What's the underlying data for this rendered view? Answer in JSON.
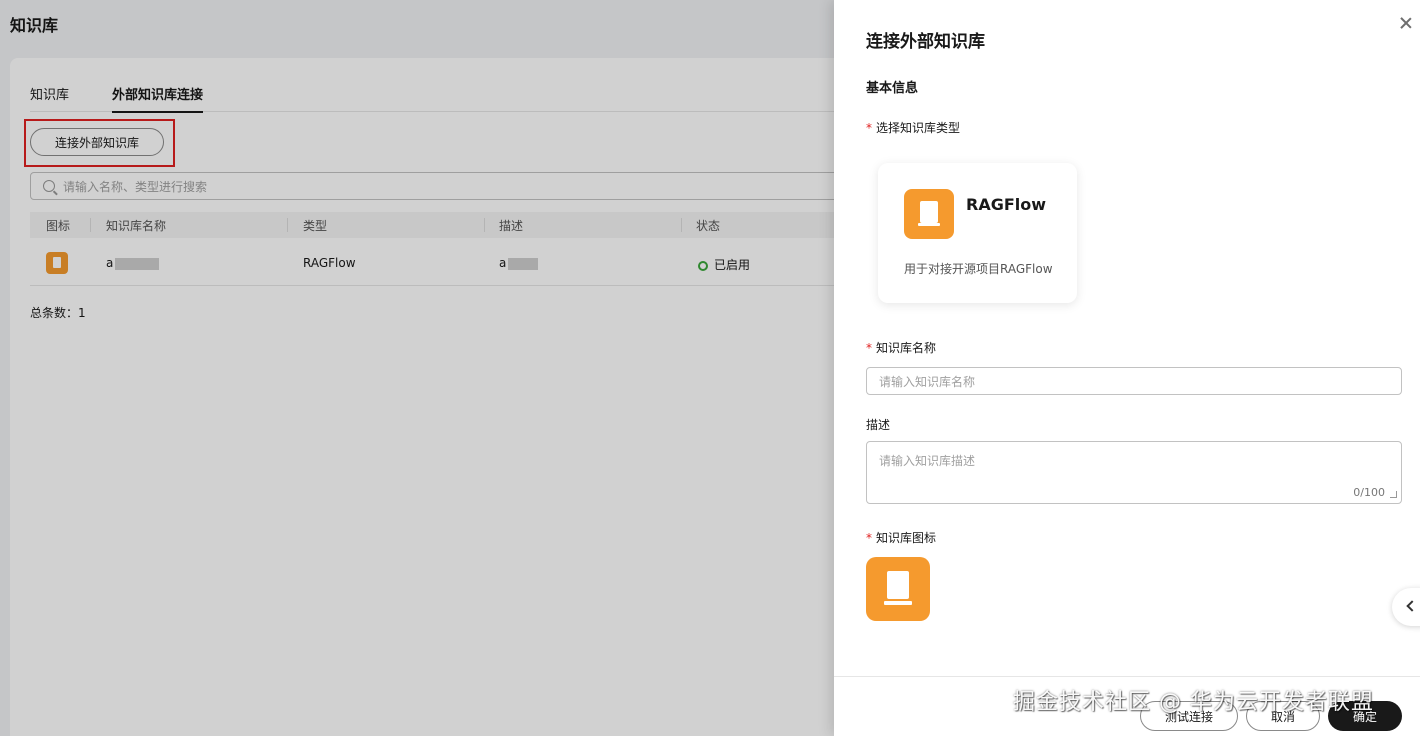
{
  "page": {
    "title": "知识库",
    "tabs": [
      {
        "label": "知识库"
      },
      {
        "label": "外部知识库连接"
      }
    ],
    "connect_button": "连接外部知识库",
    "search_placeholder": "请输入名称、类型进行搜索",
    "table": {
      "columns": [
        "图标",
        "知识库名称",
        "类型",
        "描述",
        "状态"
      ],
      "rows": [
        {
          "name": "a",
          "type": "RAGFlow",
          "description": "a",
          "status": "已启用"
        }
      ]
    },
    "total": "总条数：1"
  },
  "drawer": {
    "title": "连接外部知识库",
    "section_title": "基本信息",
    "type_label": "选择知识库类型",
    "type_card": {
      "name": "RAGFlow",
      "description": "用于对接开源项目RAGFlow",
      "icon": "book-icon"
    },
    "name_label": "知识库名称",
    "name_placeholder": "请输入知识库名称",
    "desc_label": "描述",
    "desc_placeholder": "请输入知识库描述",
    "desc_counter": "0/100",
    "icon_label": "知识库图标",
    "buttons": {
      "test": "测试连接",
      "cancel": "取消",
      "ok": "确定"
    }
  },
  "watermark": "掘金技术社区 @ 华为云开发者联盟",
  "colors": {
    "accent": "#f59a2e",
    "required": "#e02020",
    "primary_button": "#191919",
    "status_ok": "#3aa63a",
    "highlight": "#e02020"
  }
}
